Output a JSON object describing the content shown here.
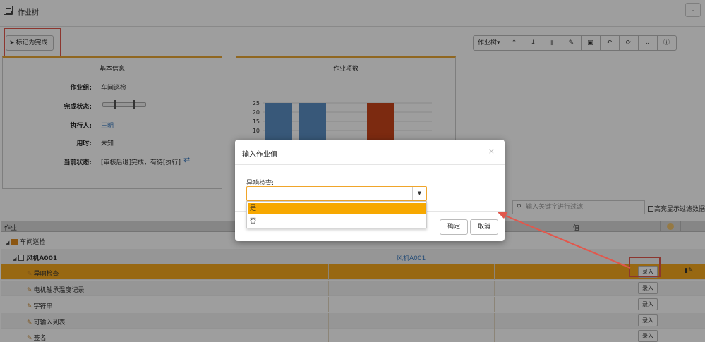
{
  "topbar": {
    "title": "作业树",
    "collapse_icon": "chevron-down-icon"
  },
  "toolbar": {
    "mark_label": "标记为完成",
    "tree_label": "作业树▾",
    "icons": [
      "arrow-up-icon",
      "arrow-down-icon",
      "trash-icon",
      "edit-icon",
      "stamp-icon",
      "undo-icon",
      "refresh-icon",
      "chevron-down-icon",
      "info-icon"
    ]
  },
  "basic_info": {
    "title": "基本信息",
    "group_label": "作业组:",
    "group_value": "车间巡检",
    "status_label": "完成状态:",
    "executor_label": "执行人:",
    "executor_value": "王明",
    "time_label": "用时:",
    "time_value": "未知",
    "current_label": "当前状态:",
    "current_value": "[审核后退]完成，有待[执行]"
  },
  "chart_data": {
    "type": "bar",
    "title": "作业项数",
    "yticks": [
      "25",
      "20",
      "15",
      "10"
    ],
    "ylim": [
      0,
      25
    ],
    "values": [
      25,
      25,
      0,
      25
    ],
    "colors": [
      "#5b8ec4",
      "#5b8ec4",
      "#5b8ec4",
      "#c8451b"
    ]
  },
  "filter": {
    "placeholder": "输入关键字进行过滤",
    "highlight_label": "高亮显示过滤数据"
  },
  "grid": {
    "col_task": "作业",
    "col_value": "值",
    "rows": [
      {
        "name": "车间巡检",
        "value": "",
        "type": "group"
      },
      {
        "name": "风机A001",
        "value": "风机A001",
        "type": "device"
      },
      {
        "name": "异响检查",
        "value": "",
        "type": "item",
        "button": "录入"
      },
      {
        "name": "电机轴承温度记录",
        "value": "",
        "type": "item",
        "button": "录入"
      },
      {
        "name": "字符串",
        "value": "",
        "type": "item",
        "button": "录入"
      },
      {
        "name": "可输入列表",
        "value": "",
        "type": "item",
        "button": "录入"
      },
      {
        "name": "签名",
        "value": "",
        "type": "item",
        "button": "录入"
      }
    ]
  },
  "modal": {
    "title": "输入作业值",
    "field_label": "异响检查:",
    "value": "",
    "options": [
      "是",
      "否"
    ],
    "ok_label": "确定",
    "cancel_label": "取消"
  },
  "colors": {
    "accent": "#f7a800",
    "annotation": "#e2574c",
    "link": "#3b7bc0"
  }
}
